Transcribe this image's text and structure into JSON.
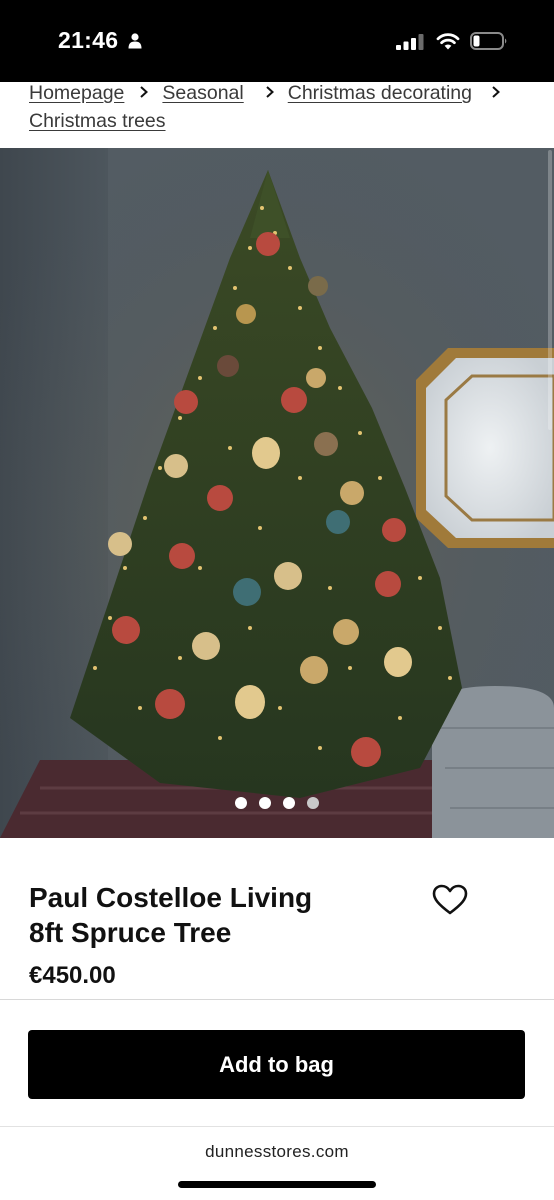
{
  "status_bar": {
    "time": "21:46",
    "icons": [
      "person-icon",
      "signal-icon",
      "wifi-icon",
      "battery-icon"
    ]
  },
  "breadcrumb": {
    "items": [
      "Homepage",
      "Seasonal",
      "Christmas decorating",
      "Christmas trees"
    ],
    "separator_icon": "chevron-right-icon"
  },
  "product": {
    "image_alt_icon": "product-photo",
    "carousel": {
      "total": 4,
      "active": 0
    },
    "title_line1": "Paul Costelloe Living",
    "title_line2": "8ft Spruce Tree",
    "price": "€450.00",
    "wishlist_icon": "heart-icon"
  },
  "actions": {
    "add_to_bag_label": "Add to bag"
  },
  "browser": {
    "url": "dunnesstores.com"
  },
  "colors": {
    "status_bar_bg": "#000000",
    "button_bg": "#000000",
    "button_text": "#ffffff",
    "text": "#111111",
    "link": "#3a3a3a"
  }
}
